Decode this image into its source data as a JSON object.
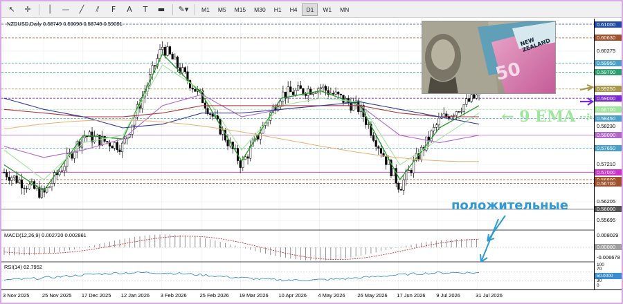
{
  "toolbar": {
    "tools": [
      {
        "name": "cursor-icon",
        "glyph": "↖"
      },
      {
        "name": "crosshair-icon",
        "glyph": "✛"
      },
      {
        "name": "vertical-line-icon",
        "glyph": "│"
      },
      {
        "name": "horizontal-line-icon",
        "glyph": "—"
      },
      {
        "name": "trendline-icon",
        "glyph": "╱"
      },
      {
        "name": "equidistant-channel-icon",
        "glyph": "⫽"
      },
      {
        "name": "fibonacci-icon",
        "glyph": "F"
      },
      {
        "name": "text-icon",
        "glyph": "A"
      },
      {
        "name": "text-label-icon",
        "glyph": "T"
      },
      {
        "name": "rectangle-icon",
        "glyph": "▬"
      },
      {
        "name": "shapes-menu-icon",
        "glyph": "✎▾"
      }
    ],
    "timeframes": [
      "M1",
      "M5",
      "M15",
      "M30",
      "H1",
      "H4",
      "D1",
      "W1",
      "MN"
    ],
    "active_timeframe": "D1"
  },
  "chart_header": "NZDUSD,Daily  0.58749 0.59098 0.58749 0.59091",
  "annotations": {
    "ema": "← 9 EMA",
    "positive": "положительные"
  },
  "colors": {
    "ema9": "#2e9e2e",
    "ema_light": "#9ee69a",
    "ma_purple": "#b266cc",
    "ma_orange": "#e8b070",
    "ma_brown": "#b0303a",
    "ma_blue": "#303aa0",
    "annot_blue": "#2f9ad6",
    "accent_olive": "#a89a4a",
    "accent_purple": "#7a2bd8"
  },
  "chart_data": [
    {
      "type": "candlestick",
      "symbol": "NZDUSD",
      "timeframe": "Daily",
      "last_ohlc": {
        "open": 0.58749,
        "high": 0.59098,
        "low": 0.58749,
        "close": 0.59091
      },
      "x": [
        "3 Nov 2025",
        "25 Nov 2025",
        "17 Dec 2025",
        "12 Jan 2026",
        "3 Feb 2026",
        "25 Feb 2026",
        "19 Mar 2026",
        "10 Apr 2026",
        "4 May 2026",
        "26 May 2026",
        "17 Jun 2026",
        "9 Jul 2026",
        "31 Jul 2026"
      ],
      "close": [
        0.57,
        0.564,
        0.58,
        0.577,
        0.604,
        0.59,
        0.572,
        0.591,
        0.593,
        0.587,
        0.566,
        0.584,
        0.5909
      ],
      "price_axis_labels": [
        "0.61000",
        "0.60630",
        "0.60275",
        "0.59950",
        "0.59700",
        "0.59250",
        "0.59000",
        "0.58700",
        "0.58450",
        "0.58230",
        "0.58000",
        "0.57650",
        "0.57210",
        "0.57000",
        "0.56800",
        "0.56700",
        "0.56205",
        "0.56000",
        "0.55695"
      ],
      "highlighted_levels": [
        {
          "value": "0.61000",
          "color": "#1f4aa8"
        },
        {
          "value": "0.60630",
          "color": "#a0522d"
        },
        {
          "value": "0.59950",
          "color": "#4aa0c8"
        },
        {
          "value": "0.59700",
          "color": "#2e9e6e"
        },
        {
          "value": "0.59250",
          "color": "#a89a4a"
        },
        {
          "value": "0.59000",
          "color": "#7a2bd8"
        },
        {
          "value": "0.58700",
          "color": "#9ee69a"
        },
        {
          "value": "0.58450",
          "color": "#4aa0c8"
        },
        {
          "value": "0.58000",
          "color": "#b266cc"
        },
        {
          "value": "0.57650",
          "color": "#4aa0c8"
        },
        {
          "value": "0.57000",
          "color": "#cc33cc"
        },
        {
          "value": "0.56800",
          "color": "#a0522d"
        },
        {
          "value": "0.56700",
          "color": "#a0522d"
        },
        {
          "value": "0.56000",
          "color": "#555555"
        }
      ],
      "series": [
        {
          "values": [
            0.572,
            0.565,
            0.58,
            0.579,
            0.602,
            0.591,
            0.573,
            0.59,
            0.592,
            0.588,
            0.568,
            0.582,
            0.588
          ]
        },
        {
          "values": [
            0.576,
            0.568,
            0.578,
            0.58,
            0.599,
            0.592,
            0.576,
            0.588,
            0.59,
            0.589,
            0.572,
            0.579,
            0.586
          ]
        },
        {
          "values": [
            0.577,
            0.574,
            0.576,
            0.579,
            0.588,
            0.591,
            0.585,
            0.587,
            0.588,
            0.588,
            0.58,
            0.578,
            0.58
          ]
        },
        {
          "values": [
            0.587,
            0.586,
            0.585,
            0.585,
            0.586,
            0.588,
            0.588,
            0.588,
            0.588,
            0.588,
            0.586,
            0.585,
            0.585
          ]
        },
        {
          "values": [
            0.59,
            0.587,
            0.585,
            0.582,
            0.583,
            0.586,
            0.586,
            0.587,
            0.588,
            0.589,
            0.587,
            0.585,
            0.583
          ]
        }
      ]
    },
    {
      "type": "histogram",
      "title": "MACD(12,26,9) 0.002720 0.002861",
      "axis_labels": [
        "0.008029",
        "0.00000",
        "-0.006678"
      ]
    },
    {
      "type": "line",
      "title": "RSI(14) 62.7952",
      "axis_labels": [
        "100",
        "70",
        "50.0000",
        "30",
        "0"
      ]
    }
  ],
  "time_axis_labels": [
    "3 Nov 2025",
    "25 Nov 2025",
    "17 Dec 2025",
    "12 Jan 2026",
    "3 Feb 2026",
    "25 Feb 2026",
    "19 Mar 2026",
    "10 Apr 2026",
    "4 May 2026",
    "26 May 2026",
    "17 Jun 2026",
    "9 Jul 2026",
    "31 Jul 2026"
  ],
  "photo_text": {
    "banknote_value": "50",
    "banknote_country": "NEW ZEALAND"
  }
}
